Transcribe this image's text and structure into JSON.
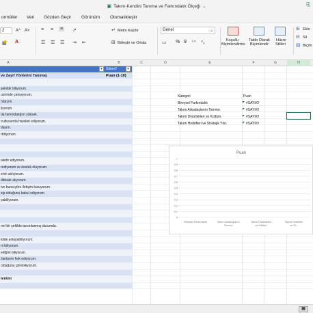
{
  "window": {
    "title": "Takım-Kendini Tanıma ve Farkındalık Ölçeği",
    "title_suffix": "⌄"
  },
  "menu": [
    "ormüller",
    "Veri",
    "Gözden Geçir",
    "Görünüm",
    "Otomatikleştir"
  ],
  "ribbon": {
    "font_size": "2",
    "font_grow": "A^",
    "font_shrink": "A˅",
    "wrap_text": "Metni Kaydır",
    "merge_center": "Birleştir ve Ortala",
    "number_format": "Genel",
    "percent": "%",
    "thousands": "9",
    "conditional": [
      "Koşullu",
      "Biçimlendirme"
    ],
    "as_table": [
      "Tablo Olarak",
      "Biçimlendir"
    ],
    "cell_styles": [
      "Hücre",
      "Stilleri"
    ],
    "insert": "Ekle",
    "delete": "Sil",
    "format": "Biçim"
  },
  "columns": [
    "A",
    "B",
    "C",
    "D",
    "E",
    "F",
    "G",
    "H"
  ],
  "sheet": {
    "header_a": "",
    "header_b": "Sütun2",
    "subheader_a": "ve Zayıf Yönlerini Tanıma)",
    "subheader_b": "Puan (1-10)",
    "rows_a": [
      "",
      "şekilde biliyorum.",
      "ızerinde çalışıyorum.",
      "ndayım.",
      "liyorum.",
      "da farkındalığım yüksek.",
      "ırultusunda hareket ediyorum.",
      "dayım.",
      "rbiliyorum.",
      "",
      "",
      "",
      "takdir ediyorum.",
      "rediyorum ve destek oluyorum.",
      "erini anlıyorum.",
      "dikkate alıyorum.",
      "ive buna göre iletişim kuruyorum.",
      "sip olduğunu kabul ediyorum.",
      "yabiliyorum.",
      "",
      "",
      "",
      "net bir şekilde tanımlanmış durumda.",
      "",
      "kilde anlayabiliyorum.",
      "ni biliyorum.",
      "ediğini biliyorum.",
      "ılanlarını fark ediyorum.",
      "olduğunu görebiliyorum.",
      "",
      "lenimi",
      ""
    ]
  },
  "summary": {
    "header_label": "Kategori",
    "header_value": "Puan",
    "items": [
      {
        "label": "Bireysel Farkındalık",
        "value": "#SAYI/0!"
      },
      {
        "label": "Takım Arkadaşlarını Tanıma",
        "value": "#SAYI/0!"
      },
      {
        "label": "Takım Dinamikleri ve Kültürü",
        "value": "#SAYI/0!"
      },
      {
        "label": "Takım Hedefleri ve Stratejik Yön.",
        "value": "#SAYI/0!"
      }
    ]
  },
  "chart_data": {
    "type": "bar",
    "title": "Puan",
    "categories": [
      "Bireysel Farkındalık",
      "Takım Arkadaşlarını Tanıma",
      "Takım Dinamikleri ve Kültürü",
      "Takım Hedefleri ve St..."
    ],
    "values": [
      0,
      0,
      0,
      0
    ],
    "yticks": [
      "1",
      "0,9",
      "0,8",
      "0,7",
      "0,6",
      "0,5",
      "0,4",
      "0,3",
      "0,2",
      "0,1",
      "0"
    ],
    "ylim": [
      0,
      1
    ]
  }
}
